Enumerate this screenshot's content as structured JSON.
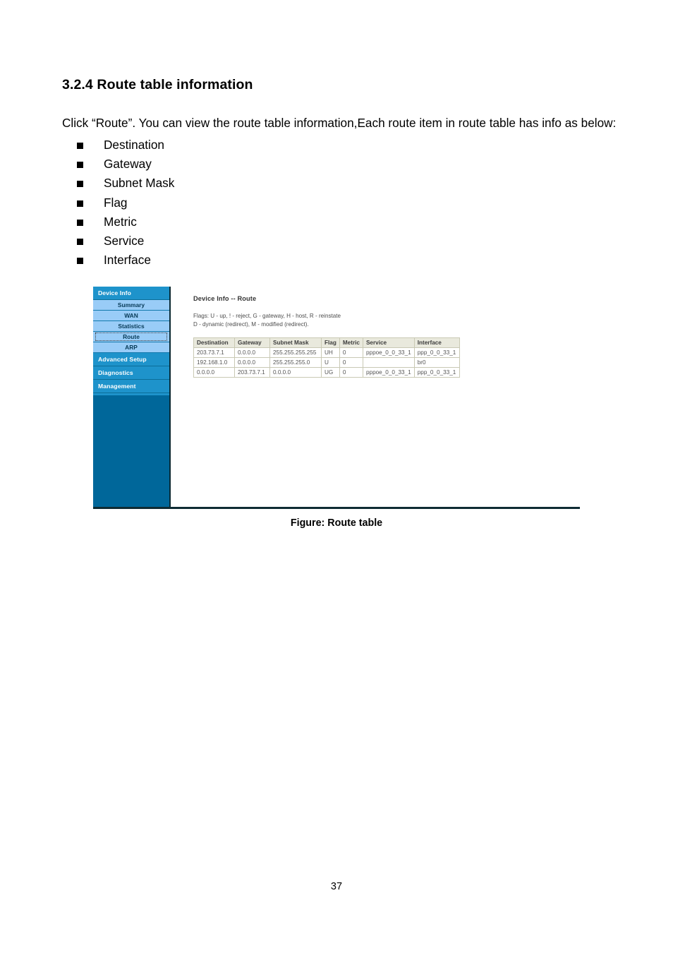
{
  "document": {
    "heading": "3.2.4 Route table information",
    "paragraph": "Click “Route”. You can view the route table information,Each route item in route table has info as below:",
    "bullets": [
      "Destination",
      "Gateway",
      "Subnet Mask",
      "Flag",
      "Metric",
      "Service",
      "Interface"
    ],
    "figure_caption": "Figure: Route table",
    "page_number": "37"
  },
  "router_ui": {
    "sidebar": {
      "sections": [
        {
          "label": "Device Info",
          "type": "section"
        },
        {
          "label": "Summary",
          "type": "sub"
        },
        {
          "label": "WAN",
          "type": "sub"
        },
        {
          "label": "Statistics",
          "type": "sub"
        },
        {
          "label": "Route",
          "type": "sub",
          "selected": true
        },
        {
          "label": "ARP",
          "type": "sub"
        },
        {
          "label": "Advanced Setup",
          "type": "section"
        },
        {
          "label": "Diagnostics",
          "type": "section"
        },
        {
          "label": "Management",
          "type": "section"
        }
      ],
      "colors": {
        "section_bg": "#1e93cb",
        "sub_bg": "#99ccf7",
        "body_bg": "#00679a",
        "border": "#0c2a33"
      }
    },
    "content": {
      "title": "Device Info -- Route",
      "flags_note": "Flags: U - up, ! - reject, G - gateway, H - host, R - reinstate\nD - dynamic (redirect), M - modified (redirect).",
      "table": {
        "columns": [
          "Destination",
          "Gateway",
          "Subnet Mask",
          "Flag",
          "Metric",
          "Service",
          "Interface"
        ],
        "rows": [
          {
            "destination": "203.73.7.1",
            "gateway": "0.0.0.0",
            "subnet_mask": "255.255.255.255",
            "flag": "UH",
            "metric": "0",
            "service": "pppoe_0_0_33_1",
            "interface": "ppp_0_0_33_1"
          },
          {
            "destination": "192.168.1.0",
            "gateway": "0.0.0.0",
            "subnet_mask": "255.255.255.0",
            "flag": "U",
            "metric": "0",
            "service": "",
            "interface": "br0"
          },
          {
            "destination": "0.0.0.0",
            "gateway": "203.73.7.1",
            "subnet_mask": "0.0.0.0",
            "flag": "UG",
            "metric": "0",
            "service": "pppoe_0_0_33_1",
            "interface": "ppp_0_0_33_1"
          }
        ]
      }
    }
  }
}
